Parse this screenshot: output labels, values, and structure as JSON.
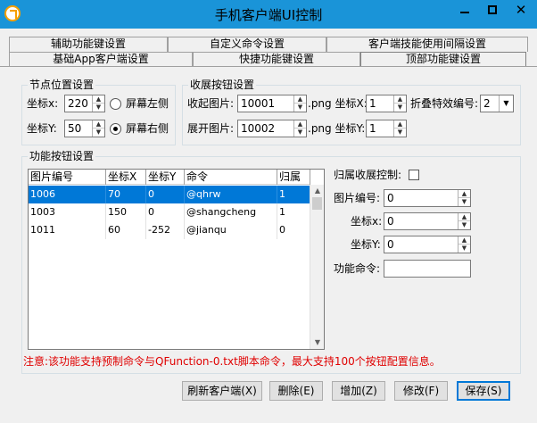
{
  "window": {
    "title": "手机客户端UI控制",
    "colors": {
      "titlebar": "#1a94d8",
      "selection": "#0078d7",
      "notice": "#e00000"
    },
    "icons": [
      "app-icon",
      "minimize-icon",
      "maximize-icon",
      "close-icon"
    ],
    "close_glyph": "✕"
  },
  "tabs": {
    "row1": [
      "辅助功能键设置",
      "自定义命令设置",
      "客户端技能使用间隔设置"
    ],
    "row2": [
      "基础App客户端设置",
      "快捷功能键设置",
      "顶部功能键设置"
    ],
    "active": "顶部功能键设置"
  },
  "node_position": {
    "title": "节点位置设置",
    "x_label": "坐标x:",
    "x_value": "220",
    "y_label": "坐标Y:",
    "y_value": "50",
    "radio_left": "屏幕左侧",
    "radio_right": "屏幕右侧",
    "selected": "屏幕右侧"
  },
  "collapse_button": {
    "title": "收展按钮设置",
    "collapse_img_label": "收起图片:",
    "collapse_img_value": "10001",
    "png_x_label": ".png 坐标X:",
    "png_x_value": "1",
    "fold_effect_label": "折叠特效编号:",
    "fold_effect_value": "2",
    "expand_img_label": "展开图片:",
    "expand_img_value": "10002",
    "png_y_label": ".png 坐标Y:",
    "png_y_value": "1"
  },
  "function_buttons": {
    "title": "功能按钮设置",
    "columns": [
      "图片编号",
      "坐标X",
      "坐标Y",
      "命令",
      "归属"
    ],
    "rows": [
      [
        "1006",
        "70",
        "0",
        "@qhrw",
        "1"
      ],
      [
        "1003",
        "150",
        "0",
        "@shangcheng",
        "1"
      ],
      [
        "1011",
        "60",
        "-252",
        "@jianqu",
        "0"
      ]
    ],
    "selected_row": 0,
    "belong_label": "归属收展控制:",
    "img_no_label": "图片编号:",
    "img_no_value": "0",
    "x_label": "坐标x:",
    "x_value": "0",
    "y_label": "坐标Y:",
    "y_value": "0",
    "cmd_label": "功能命令:",
    "cmd_value": ""
  },
  "notice": "注意:该功能支持预制命令与QFunction-0.txt脚本命令，最大支持100个按钮配置信息。",
  "buttons": {
    "refresh": "刷新客户端(X)",
    "delete": "删除(E)",
    "add": "增加(Z)",
    "modify": "修改(F)",
    "save": "保存(S)"
  }
}
